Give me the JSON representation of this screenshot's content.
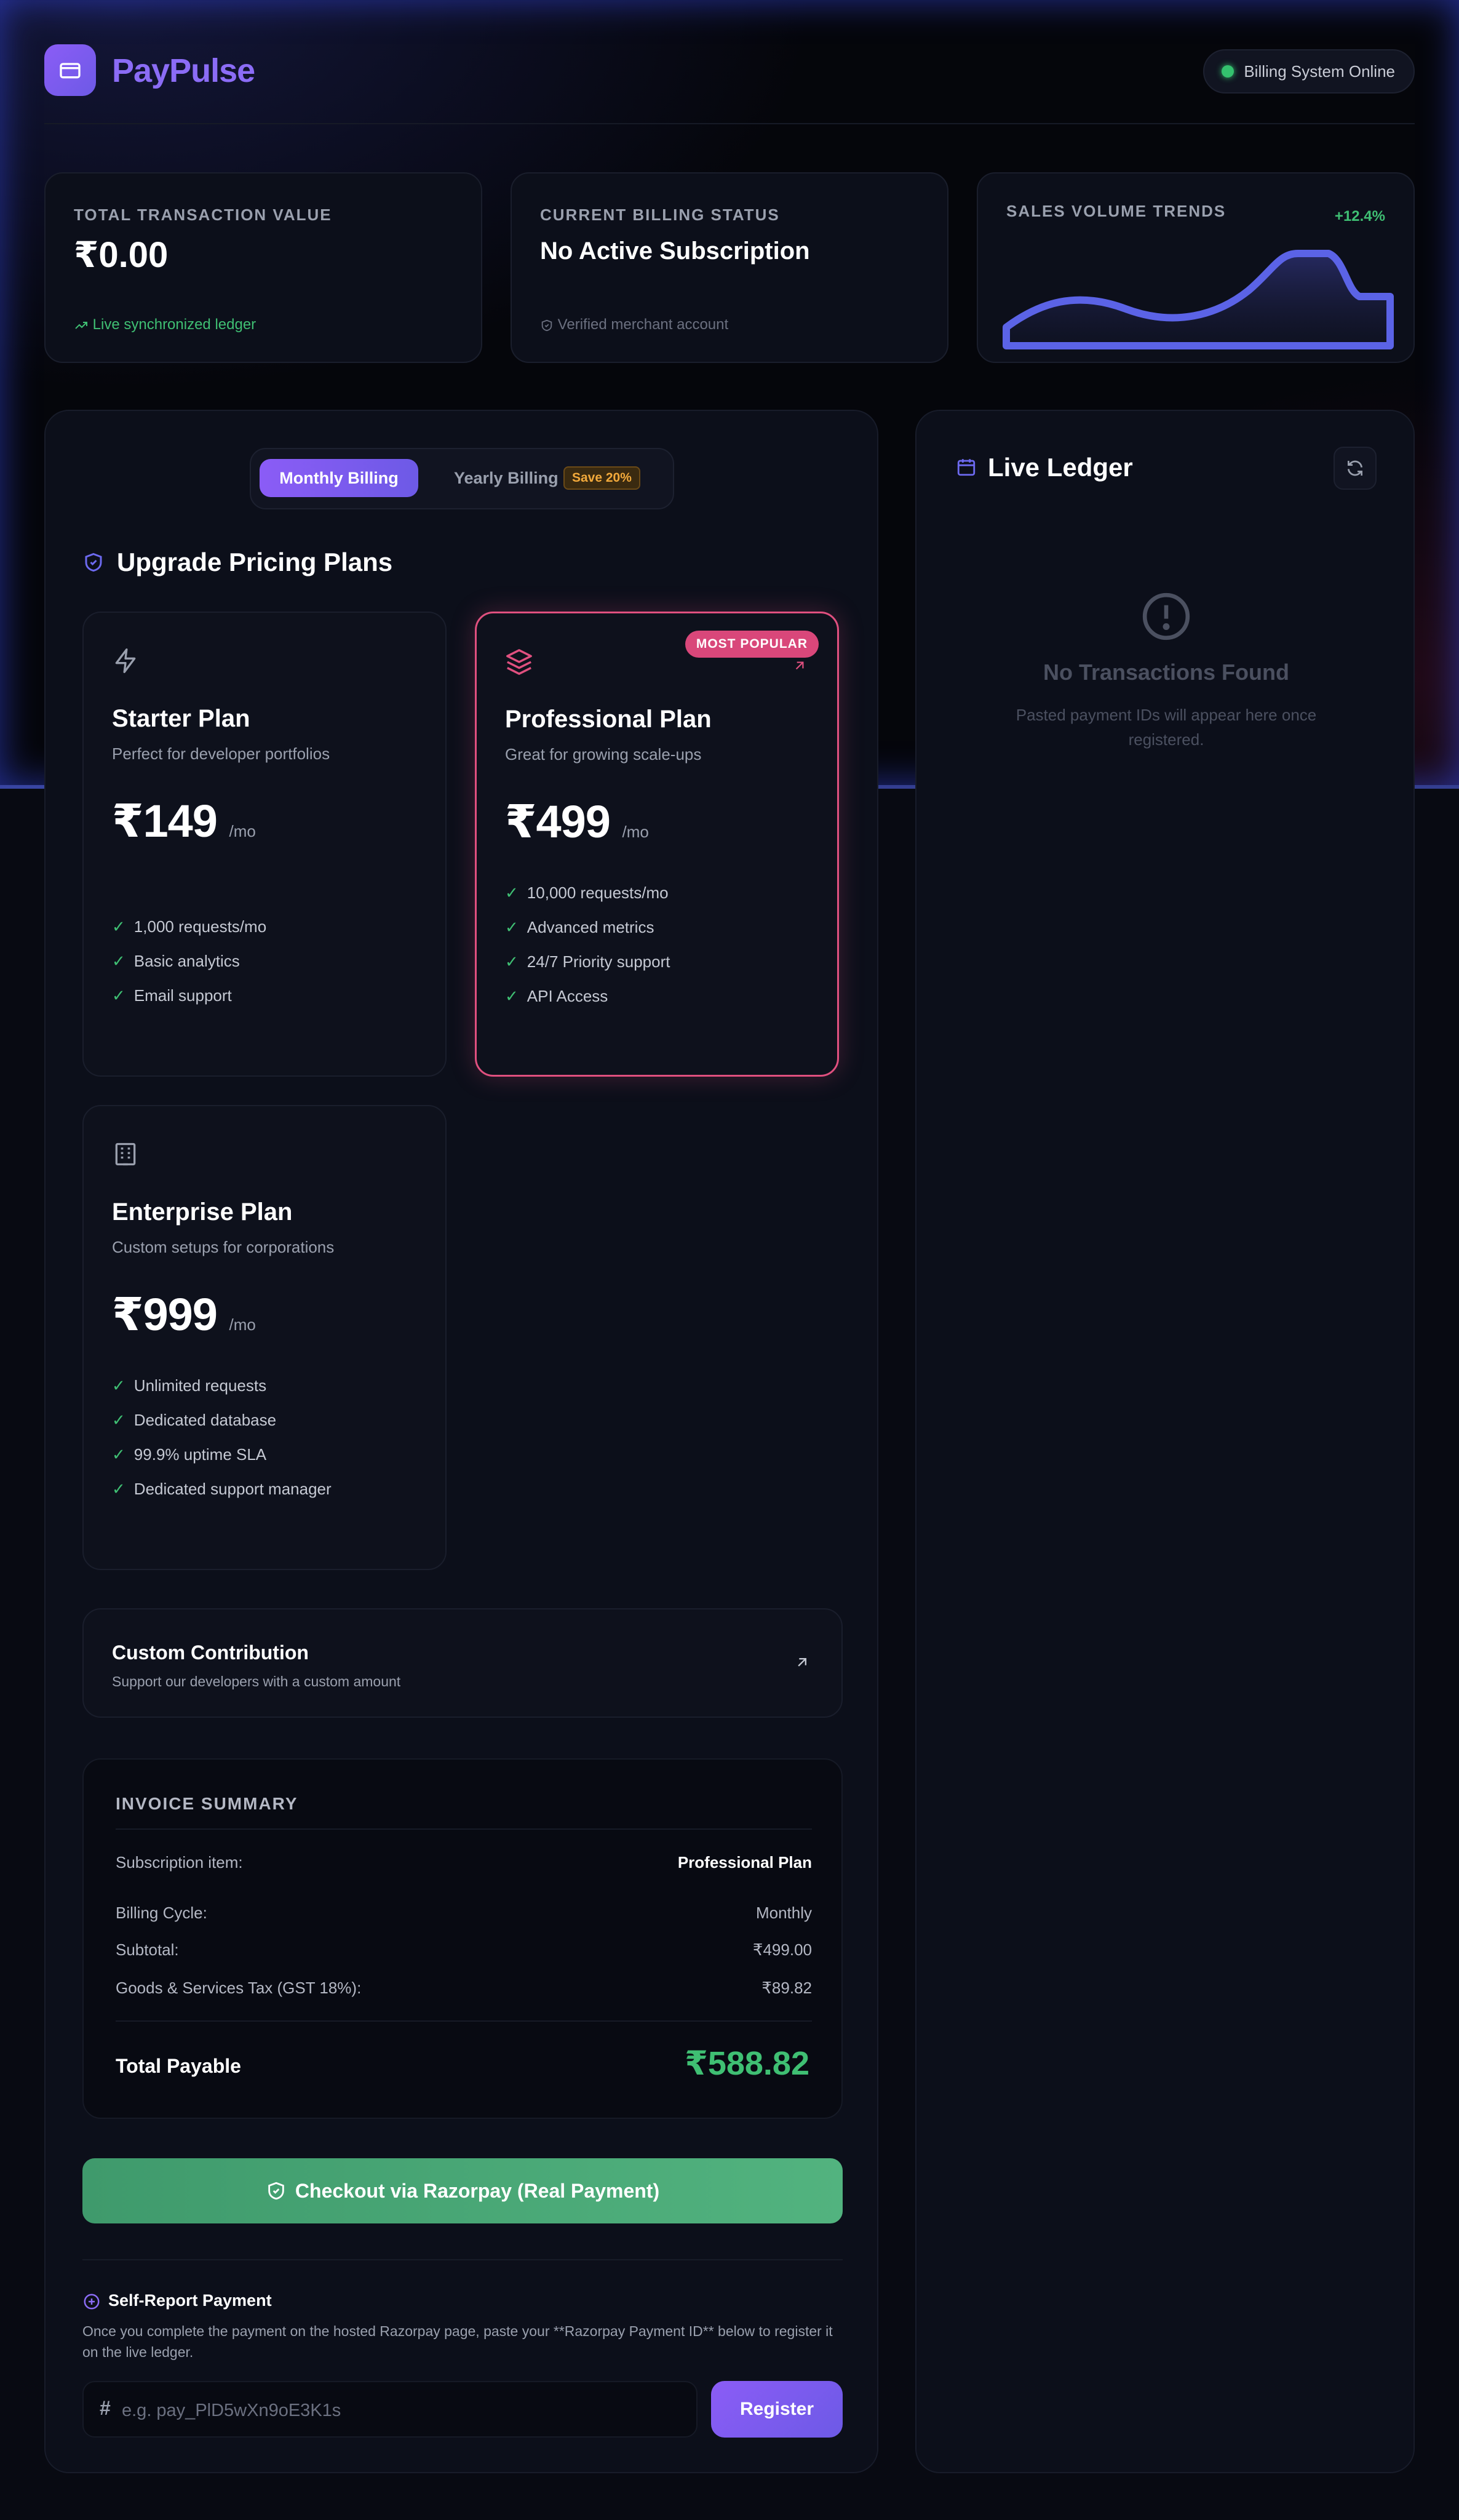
{
  "app": {
    "brand": "PayPulse",
    "status": "Billing System Online"
  },
  "stats": {
    "total": {
      "label": "TOTAL TRANSACTION VALUE",
      "value": "₹0.00",
      "foot": "Live synchronized ledger"
    },
    "billing": {
      "label": "CURRENT BILLING STATUS",
      "value": "No Active Subscription",
      "foot": "Verified merchant account"
    },
    "trends": {
      "label": "SALES VOLUME TRENDS",
      "change": "+12.4%"
    }
  },
  "billing_toggle": {
    "monthly": "Monthly Billing",
    "yearly": "Yearly Billing",
    "save": "Save 20%"
  },
  "plans_title": "Upgrade Pricing Plans",
  "plans": [
    {
      "name": "Starter Plan",
      "desc": "Perfect for developer portfolios",
      "price": "₹149",
      "per": "/mo",
      "features": [
        "1,000 requests/mo",
        "Basic analytics",
        "Email support"
      ]
    },
    {
      "name": "Professional Plan",
      "desc": "Great for growing scale-ups",
      "price": "₹499",
      "per": "/mo",
      "badge": "MOST POPULAR",
      "features": [
        "10,000 requests/mo",
        "Advanced metrics",
        "24/7 Priority support",
        "API Access"
      ]
    },
    {
      "name": "Enterprise Plan",
      "desc": "Custom setups for corporations",
      "price": "₹999",
      "per": "/mo",
      "features": [
        "Unlimited requests",
        "Dedicated database",
        "99.9% uptime SLA",
        "Dedicated support manager"
      ]
    }
  ],
  "custom": {
    "title": "Custom Contribution",
    "subtitle": "Support our developers with a custom amount"
  },
  "invoice": {
    "title": "INVOICE SUMMARY",
    "item_label": "Subscription item:",
    "item_value": "Professional Plan",
    "cycle_label": "Billing Cycle:",
    "cycle_value": "Monthly",
    "subtotal_label": "Subtotal:",
    "subtotal_value": "₹499.00",
    "tax_label": "Goods & Services Tax (GST 18%):",
    "tax_value": "₹89.82",
    "total_label": "Total Payable",
    "total_value": "₹588.82"
  },
  "checkout_label": "Checkout via Razorpay (Real Payment)",
  "self_report": {
    "title": "Self-Report Payment",
    "desc": "Once you complete the payment on the hosted Razorpay page, paste your **Razorpay Payment ID** below to register it on the live ledger.",
    "placeholder": "e.g. pay_PlD5wXn9oE3K1s",
    "hash": "#",
    "register": "Register"
  },
  "ledger": {
    "title": "Live Ledger",
    "empty_title": "No Transactions Found",
    "empty_sub": "Pasted payment IDs will appear here once registered."
  },
  "colors": {
    "accent": "#8b5cf6",
    "success": "#3fbf73",
    "popular": "#d9477a",
    "badge": "#f2a93b"
  }
}
